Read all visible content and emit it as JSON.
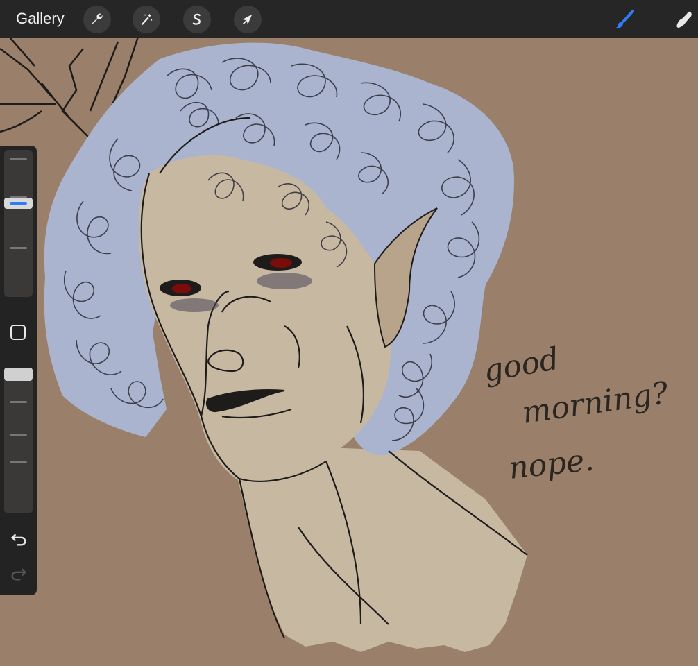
{
  "app": {
    "gallery_label": "Gallery"
  },
  "toolbar": {
    "left_tools": [
      {
        "name": "actions",
        "icon": "wrench-icon"
      },
      {
        "name": "adjustments",
        "icon": "magic-wand-icon"
      },
      {
        "name": "selection",
        "icon": "selection-s-icon"
      },
      {
        "name": "transform",
        "icon": "arrow-cursor-icon"
      }
    ],
    "right_tools": [
      {
        "name": "brush",
        "icon": "brush-icon",
        "active": true
      },
      {
        "name": "smudge",
        "icon": "smudge-finger-icon",
        "active": false
      }
    ],
    "active_color": "#2f7cf6"
  },
  "sidebar": {
    "brush_size_level": 0.65,
    "opacity_level": 1.0,
    "undo_icon": "undo-icon",
    "redo_icon": "redo-icon",
    "modify_icon": "square-modify-icon"
  },
  "artwork": {
    "handwritten_text": [
      "good",
      "morning?",
      "nope."
    ],
    "colors": {
      "background": "#9a806a",
      "hair": "#aab4cf",
      "skin": "#c7b8a2",
      "lines": "#1e1c1a",
      "eyes": "#7a0c0c"
    }
  }
}
